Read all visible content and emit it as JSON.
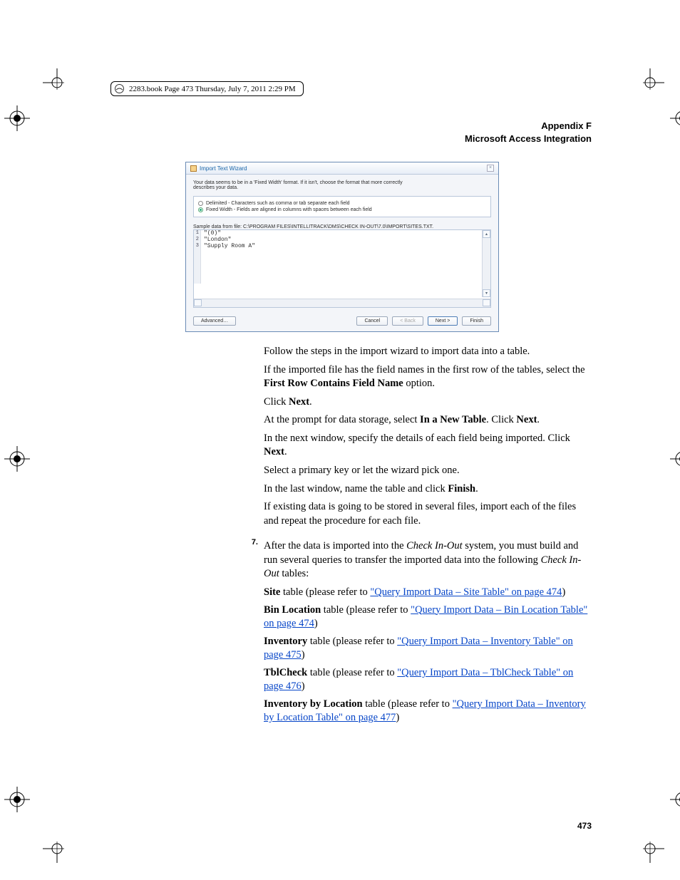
{
  "book_header": "2283.book  Page 473  Thursday, July 7, 2011  2:29 PM",
  "running_head_1": "Appendix F",
  "running_head_2": "Microsoft Access Integration",
  "wizard": {
    "title": "Import Text Wizard",
    "intro": "Your data seems to be in a 'Fixed Width' format. If it isn't, choose the format that more correctly describes your data.",
    "opt_delimited": "Delimited - Characters such as comma or tab separate each field",
    "opt_fixed": "Fixed Width - Fields are aligned in columns with spaces between each field",
    "sample_label": "Sample data from file: C:\\PROGRAM FILES\\INTELLITRACK\\DMS\\CHECK IN-OUT\\7.0\\IMPORT\\SITES.TXT.",
    "row1": "\"(0)\"",
    "row2": "\"London\"",
    "row3": "\"Supply Room A\"",
    "btn_advanced": "Advanced…",
    "btn_cancel": "Cancel",
    "btn_back": "< Back",
    "btn_next": "Next >",
    "btn_finish": "Finish"
  },
  "p1": "Follow the steps in the import wizard to import data into a table.",
  "p2a": "If the imported file has the field names in the first row of the tables, select the ",
  "p2b": "First Row Contains Field Name",
  "p2c": " option.",
  "p3a": "Click ",
  "p3b": "Next",
  "p3c": ".",
  "p4a": "At the prompt for data storage, select ",
  "p4b": "In a New Table",
  "p4c": ". Click ",
  "p4d": "Next",
  "p4e": ".",
  "p5a": "In the next window, specify the details of each field being imported. Click ",
  "p5b": "Next",
  "p5c": ".",
  "p6": "Select a primary key or let the wizard pick one.",
  "p7a": "In the last window, name the table and click ",
  "p7b": "Finish",
  "p7c": ".",
  "p8": "If existing data is going to be stored in several files, import each of the files and repeat the procedure for each file.",
  "step_num": "7.",
  "p9a": "After the data is imported into the ",
  "p9b": "Check In-Out",
  "p9c": " system, you must build and run several queries to transfer the imported data into the following ",
  "p9d": "Check In-Out",
  "p9e": " tables:",
  "t1a": "Site",
  "t1b": " table (please refer to ",
  "t1c": "\"Query Import Data – Site Table\" on page 474",
  "t1d": ")",
  "t2a": "Bin Location",
  "t2b": " table (please refer to ",
  "t2c": "\"Query Import Data – Bin Location Table\" on page 474",
  "t2d": ")",
  "t3a": "Inventory",
  "t3b": " table (please refer to ",
  "t3c": "\"Query Import Data – Inventory Table\" on page 475",
  "t3d": ")",
  "t4a": "TblCheck",
  "t4b": " table (please refer to ",
  "t4c": "\"Query Import Data – TblCheck Table\" on page 476",
  "t4d": ")",
  "t5a": "Inventory by Location",
  "t5b": " table (please refer to ",
  "t5c": "\"Query Import Data – Inventory by Location Table\" on page 477",
  "t5d": ")",
  "page_number": "473"
}
